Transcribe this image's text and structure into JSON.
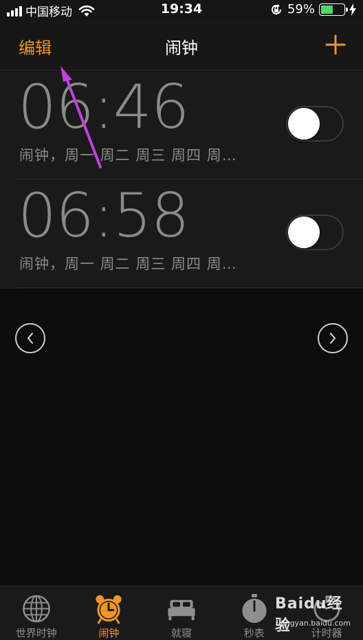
{
  "status_bar": {
    "carrier": "中国移动",
    "time": "19:34",
    "battery_percent": "59%",
    "battery_level": 0.59,
    "icons": [
      "signal-icon",
      "wifi-icon",
      "rotation-lock-icon",
      "battery-icon",
      "charging-icon"
    ]
  },
  "nav": {
    "edit_label": "编辑",
    "title": "闹钟",
    "add_icon": "plus-icon",
    "accent_color": "#f0952a"
  },
  "alarms": [
    {
      "time": "06:46",
      "label": "闹钟，周一 周二 周三 周四 周…",
      "enabled": false
    },
    {
      "time": "06:58",
      "label": "闹钟，周一 周二 周三 周四 周…",
      "enabled": false
    }
  ],
  "pager": {
    "prev_icon": "chevron-left-icon",
    "next_icon": "chevron-right-icon"
  },
  "tabs": [
    {
      "label": "世界时钟",
      "icon": "globe-icon",
      "active": false
    },
    {
      "label": "闹钟",
      "icon": "alarm-clock-icon",
      "active": true
    },
    {
      "label": "就寝",
      "icon": "bed-icon",
      "active": false
    },
    {
      "label": "秒表",
      "icon": "stopwatch-icon",
      "active": false
    },
    {
      "label": "计时器",
      "icon": "timer-icon",
      "active": false
    }
  ],
  "watermark": {
    "main": "Baidu经验",
    "sub": "jingyan.baidu.com"
  },
  "annotation": {
    "color": "#c040e0"
  }
}
